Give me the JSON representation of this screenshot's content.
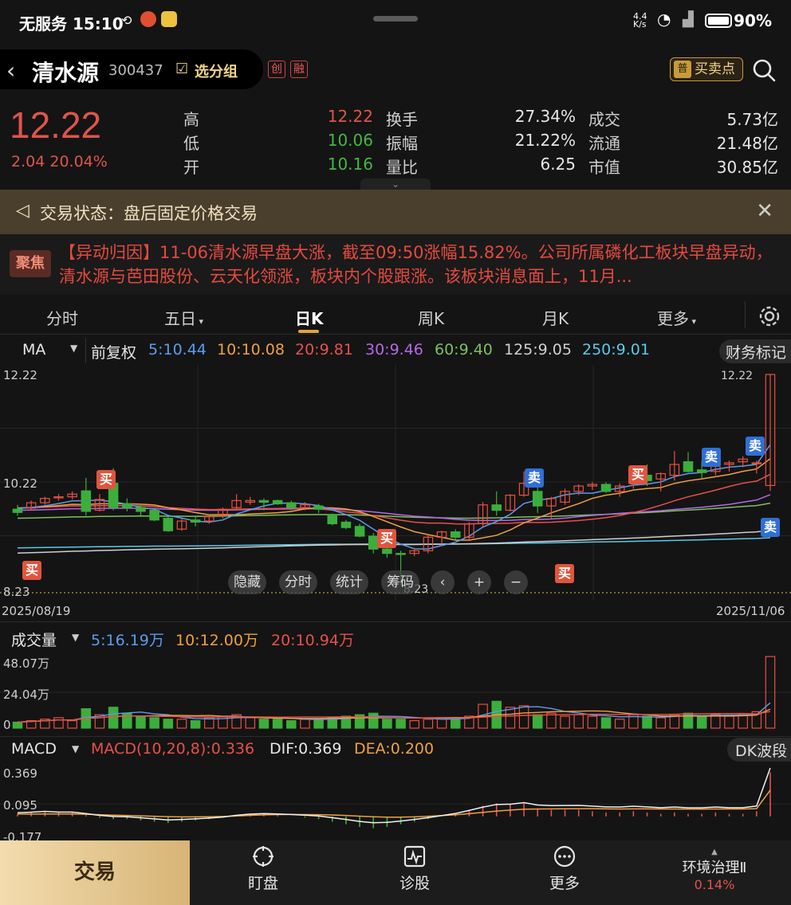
{
  "status_bar": {
    "carrier_time": "无服务 15:10",
    "battery": "90%",
    "net_speed": "4.4 K/s"
  },
  "header": {
    "stock_name": "清水源",
    "stock_code": "300437",
    "group_label": "选分组",
    "tag_chuang": "创",
    "tag_rong": "融",
    "bs_points_label": "买卖点",
    "bs_points_badge": "普"
  },
  "quote": {
    "price": "12.22",
    "change": "2.04",
    "change_pct": "20.04%",
    "high_label": "高",
    "high": "12.22",
    "low_label": "低",
    "low": "10.06",
    "open_label": "开",
    "open": "10.16",
    "turnover_label": "换手",
    "turnover": "27.34%",
    "amplitude_label": "振幅",
    "amplitude": "21.22%",
    "volume_ratio_label": "量比",
    "volume_ratio": "6.25",
    "deal_label": "成交",
    "deal": "5.73亿",
    "float_label": "流通",
    "float": "21.48亿",
    "mktcap_label": "市值",
    "mktcap": "30.85亿"
  },
  "banner": {
    "text": "交易状态：盘后固定价格交易"
  },
  "focus": {
    "badge": "聚焦",
    "text": "【异动归因】11-06清水源早盘大涨，截至09:50涨幅15.82%。公司所属磷化工板块早盘异动，清水源与芭田股份、云天化领涨，板块内个股跟涨。该板块消息面上，11月..."
  },
  "tabs": {
    "t1": "分时",
    "t2": "五日",
    "t3": "日K",
    "t4": "周K",
    "t5": "月K",
    "t6": "更多"
  },
  "ma_row": {
    "name": "MA",
    "adjust": "前复权",
    "ma5": "5:10.44",
    "ma10": "10:10.08",
    "ma20": "20:9.81",
    "ma30": "30:9.46",
    "ma60": "60:9.40",
    "ma125": "125:9.05",
    "ma250": "250:9.01",
    "finance_mark": "财务标记"
  },
  "kline_axis": {
    "top": "12.22",
    "mid": "10.22",
    "bottom": "8.23",
    "low_mark": "8.23",
    "high_mark": "12.22",
    "date_start": "2025/08/19",
    "date_end": "2025/11/06"
  },
  "bs_labels": {
    "buy": "买",
    "sell": "卖"
  },
  "chart_controls": {
    "hide": "隐藏",
    "fenshi": "分时",
    "stats": "统计",
    "chips": "筹码",
    "prev": "‹",
    "plus": "+",
    "minus": "−"
  },
  "vol_row": {
    "name": "成交量",
    "ma5": "5:16.19万",
    "ma10": "10:12.00万",
    "ma20": "20:10.94万",
    "axis_top": "48.07万",
    "axis_mid": "24.04万",
    "axis_bottom": "0"
  },
  "macd_row": {
    "name": "MACD",
    "params": "MACD(10,20,8):0.336",
    "dif": "DIF:0.369",
    "dea": "DEA:0.200",
    "dk_label": "DK波段",
    "axis_top": "0.369",
    "axis_mid": "0.095",
    "axis_bottom": "-0.177"
  },
  "bottom_nav": {
    "trade": "交易",
    "watch": "盯盘",
    "diagnose": "诊股",
    "more": "更多",
    "sector_name": "环境治理Ⅱ",
    "sector_pct": "0.14%"
  },
  "chart_data": [
    {
      "type": "candlestick",
      "title": "",
      "xlabel": "",
      "ylabel": "",
      "x_range": [
        "2025/08/19",
        "2025/11/06"
      ],
      "ylim": [
        8.23,
        12.22
      ],
      "series": [
        {
          "name": "OHLC",
          "values": [
            [
              9.72,
              9.8,
              9.6,
              9.66
            ],
            [
              9.74,
              9.88,
              9.7,
              9.84
            ],
            [
              9.84,
              9.95,
              9.8,
              9.92
            ],
            [
              9.93,
              10.0,
              9.88,
              9.95
            ],
            [
              9.95,
              10.05,
              9.9,
              10.0
            ],
            [
              10.06,
              10.3,
              9.6,
              9.68
            ],
            [
              9.7,
              10.0,
              9.68,
              9.9
            ],
            [
              10.2,
              10.48,
              9.7,
              9.75
            ],
            [
              9.82,
              9.92,
              9.68,
              9.75
            ],
            [
              9.75,
              9.82,
              9.6,
              9.68
            ],
            [
              9.7,
              9.72,
              9.5,
              9.52
            ],
            [
              9.55,
              9.58,
              9.3,
              9.32
            ],
            [
              9.35,
              9.55,
              9.32,
              9.5
            ],
            [
              9.52,
              9.58,
              9.4,
              9.48
            ],
            [
              9.5,
              9.62,
              9.45,
              9.58
            ],
            [
              9.6,
              9.75,
              9.55,
              9.72
            ],
            [
              9.75,
              10.0,
              9.7,
              9.88
            ],
            [
              9.85,
              9.95,
              9.8,
              9.88
            ],
            [
              9.88,
              9.92,
              9.7,
              9.85
            ],
            [
              9.88,
              9.9,
              9.8,
              9.82
            ],
            [
              9.84,
              9.88,
              9.7,
              9.75
            ],
            [
              9.75,
              9.85,
              9.7,
              9.8
            ],
            [
              9.78,
              9.82,
              9.65,
              9.72
            ],
            [
              9.62,
              9.64,
              9.42,
              9.45
            ],
            [
              9.48,
              9.52,
              9.35,
              9.38
            ],
            [
              9.4,
              9.45,
              9.2,
              9.22
            ],
            [
              9.22,
              9.28,
              8.9,
              8.98
            ],
            [
              8.98,
              9.02,
              8.82,
              8.9
            ],
            [
              8.9,
              8.95,
              8.3,
              8.88
            ],
            [
              8.9,
              9.0,
              8.85,
              8.95
            ],
            [
              8.95,
              9.25,
              8.9,
              9.2
            ],
            [
              9.2,
              9.32,
              9.05,
              9.3
            ],
            [
              9.3,
              9.35,
              9.15,
              9.2
            ],
            [
              9.2,
              9.48,
              9.15,
              9.45
            ],
            [
              9.45,
              9.85,
              9.4,
              9.8
            ],
            [
              9.8,
              10.05,
              9.6,
              9.7
            ],
            [
              9.7,
              10.0,
              9.68,
              9.98
            ],
            [
              9.98,
              10.42,
              9.95,
              10.2
            ],
            [
              10.05,
              10.15,
              9.65,
              9.78
            ],
            [
              9.78,
              9.95,
              9.55,
              9.92
            ],
            [
              9.85,
              10.1,
              9.8,
              10.05
            ],
            [
              10.05,
              10.18,
              9.98,
              10.15
            ],
            [
              10.15,
              10.22,
              10.08,
              10.18
            ],
            [
              10.18,
              10.22,
              10.02,
              10.05
            ],
            [
              10.05,
              10.2,
              9.95,
              10.15
            ],
            [
              10.2,
              10.48,
              10.1,
              10.3
            ],
            [
              10.35,
              10.55,
              10.15,
              10.25
            ],
            [
              10.28,
              10.4,
              10.05,
              10.38
            ],
            [
              10.35,
              10.8,
              10.25,
              10.55
            ],
            [
              10.6,
              10.78,
              10.4,
              10.42
            ],
            [
              10.45,
              10.62,
              10.3,
              10.4
            ],
            [
              10.42,
              10.65,
              10.35,
              10.55
            ],
            [
              10.55,
              10.62,
              10.42,
              10.58
            ],
            [
              10.6,
              10.7,
              10.5,
              10.65
            ],
            [
              10.58,
              10.62,
              10.38,
              10.58
            ],
            [
              10.16,
              12.22,
              10.06,
              12.22
            ]
          ]
        }
      ],
      "ma_lines": {
        "MA5": 10.44,
        "MA10": 10.08,
        "MA20": 9.81,
        "MA30": 9.46,
        "MA60": 9.4,
        "MA125": 9.05,
        "MA250": 9.01
      },
      "colors": {
        "up": "#e8503f",
        "down": "#3cae3c",
        "ma5": "#5b9cf0",
        "ma10": "#f0a040",
        "ma20": "#e8504a",
        "ma30": "#b468e8",
        "ma60": "#7cc05c",
        "ma125": "#cfcfcf",
        "ma250": "#5ec8e6"
      }
    },
    {
      "type": "bar",
      "title": "",
      "ylabel": "成交量",
      "ylim": [
        0,
        48.07
      ],
      "series": [
        {
          "name": "成交量",
          "values": [
            4,
            5,
            6,
            7,
            5,
            13,
            9,
            14,
            10,
            8,
            7,
            6,
            6,
            5,
            7,
            8,
            9,
            7,
            6,
            6,
            5,
            6,
            6,
            7,
            8,
            9,
            10,
            6,
            6,
            5,
            6,
            7,
            7,
            8,
            16,
            18,
            14,
            15,
            9,
            10,
            8,
            9,
            8,
            7,
            6,
            9,
            8,
            7,
            9,
            10,
            8,
            9,
            8,
            9,
            11,
            48
          ]
        }
      ]
    },
    {
      "type": "bar",
      "title": "",
      "ylabel": "MACD",
      "ylim": [
        -0.177,
        0.369
      ],
      "series": [
        {
          "name": "MACD",
          "values": [
            0.02,
            0.03,
            0.04,
            0.03,
            0.03,
            0.01,
            -0.01,
            -0.02,
            -0.02,
            -0.03,
            -0.04,
            -0.05,
            -0.04,
            -0.03,
            -0.02,
            -0.01,
            0.01,
            0.02,
            0.02,
            0.01,
            0.0,
            -0.01,
            -0.02,
            -0.04,
            -0.06,
            -0.08,
            -0.09,
            -0.08,
            -0.06,
            -0.04,
            -0.02,
            0.0,
            0.02,
            0.05,
            0.08,
            0.1,
            0.09,
            0.1,
            0.06,
            0.05,
            0.05,
            0.05,
            0.04,
            0.03,
            0.03,
            0.04,
            0.03,
            0.02,
            0.03,
            0.02,
            0.02,
            0.03,
            0.02,
            0.02,
            0.04,
            0.336
          ]
        }
      ]
    }
  ]
}
